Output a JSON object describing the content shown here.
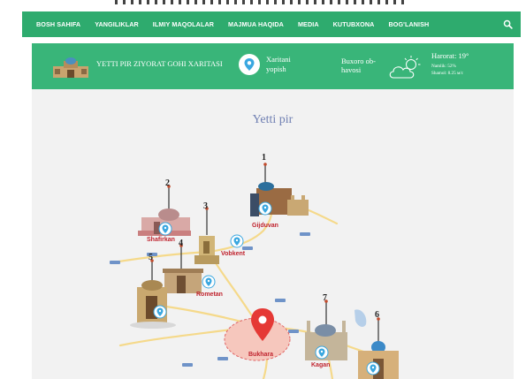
{
  "nav": {
    "items": [
      "BOSH SAHIFA",
      "YANGILIKLAR",
      "ILMIY MAQOLALAR",
      "MAJMUA HAQIDA",
      "MEDIA",
      "KUTUBXONA",
      "BOG'LANISH"
    ],
    "search_icon": "search-icon"
  },
  "infobar": {
    "title": "YETTI PIR ZIYORAT GOHI XARITASI",
    "map_toggle": "Xaritani yopish",
    "weather_label": "Buxoro ob-havosi",
    "temperature": "Harorat: 19°",
    "humidity": "Namlik: 52%",
    "wind": "Shamol: 8.25 м/с",
    "weather_icon": "partly-cloudy-icon"
  },
  "map": {
    "title": "Yetti pir",
    "cities": [
      "Shafirkan",
      "Gijduvan",
      "Vobkent",
      "Rometan",
      "Bukhara",
      "Kagan"
    ],
    "site_numbers": [
      "1",
      "2",
      "3",
      "4",
      "5",
      "6",
      "7"
    ]
  },
  "colors": {
    "nav_bg": "#2eab6e",
    "infobar_bg": "#39b579",
    "map_bg": "#f2f2f2",
    "marker_red": "#e53935",
    "pin_blue": "#3aa7e0"
  }
}
